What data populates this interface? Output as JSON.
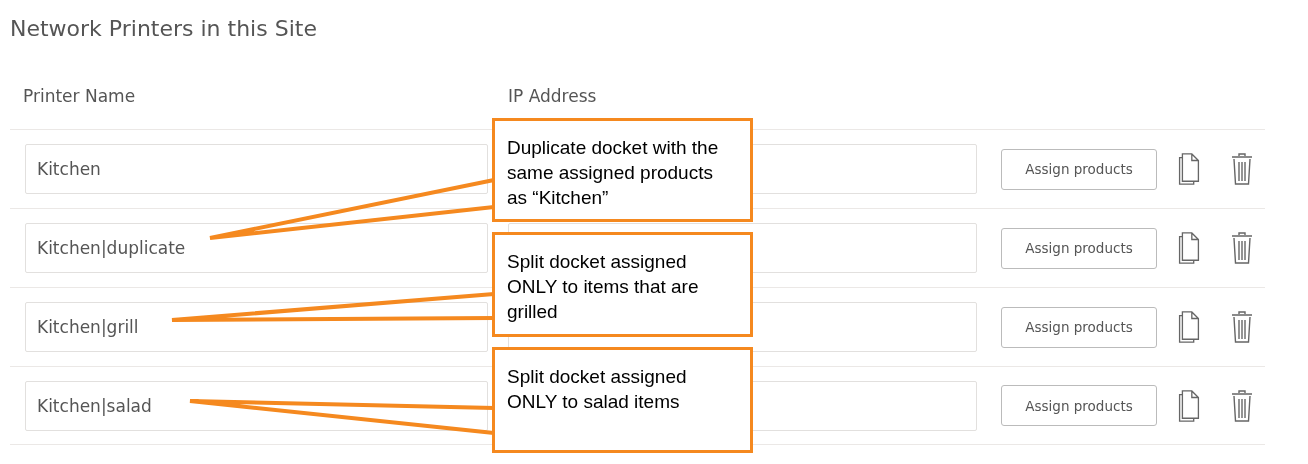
{
  "title": "Network Printers in this Site",
  "columns": [
    "Printer Name",
    "IP Address"
  ],
  "rows": [
    {
      "name": "Kitchen",
      "button": "Assign products"
    },
    {
      "name": "Kitchen|duplicate",
      "button": "Assign products"
    },
    {
      "name": "Kitchen|grill",
      "button": "Assign products"
    },
    {
      "name": "Kitchen|salad",
      "button": "Assign products"
    }
  ],
  "callouts": [
    {
      "text": "Duplicate docket with the same assigned products as “Kitchen”"
    },
    {
      "text": "Split docket assigned ONLY to items that are grilled"
    },
    {
      "text": "Split docket assigned ONLY to salad items"
    }
  ]
}
